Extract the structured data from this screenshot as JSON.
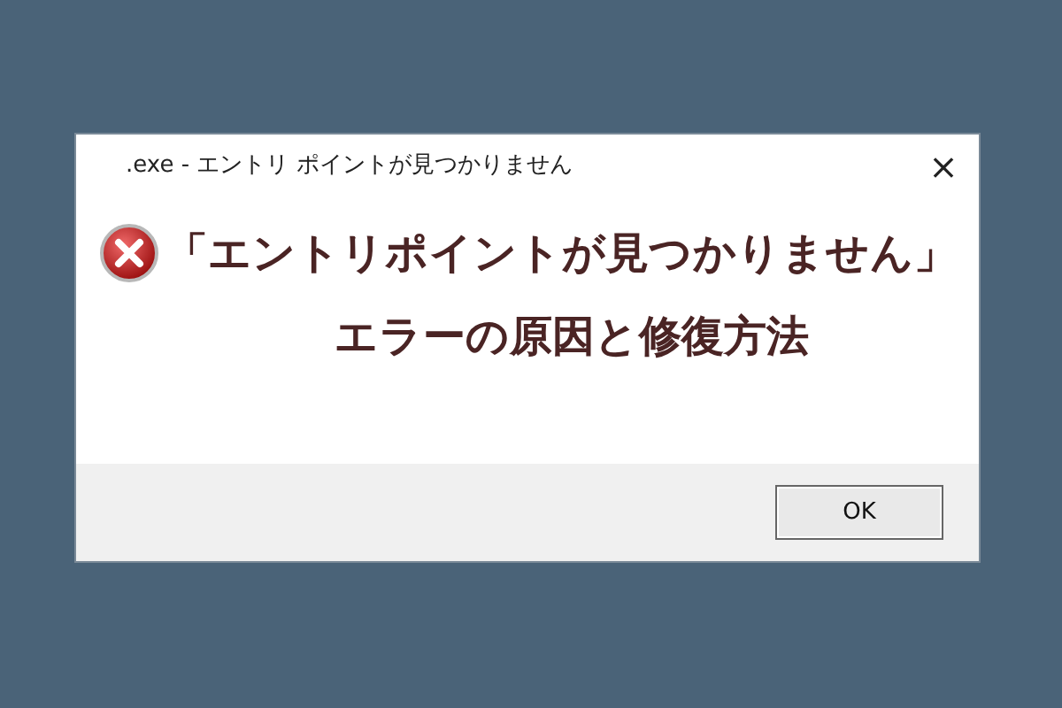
{
  "window": {
    "title": ".exe - エントリ ポイントが見つかりません",
    "close": "×"
  },
  "message": {
    "lines": [
      "「エントリポイントが見つかりません」",
      "エラーの原因と修復方法"
    ]
  },
  "buttons": [
    {
      "label": "OK",
      "selected": true
    }
  ]
}
